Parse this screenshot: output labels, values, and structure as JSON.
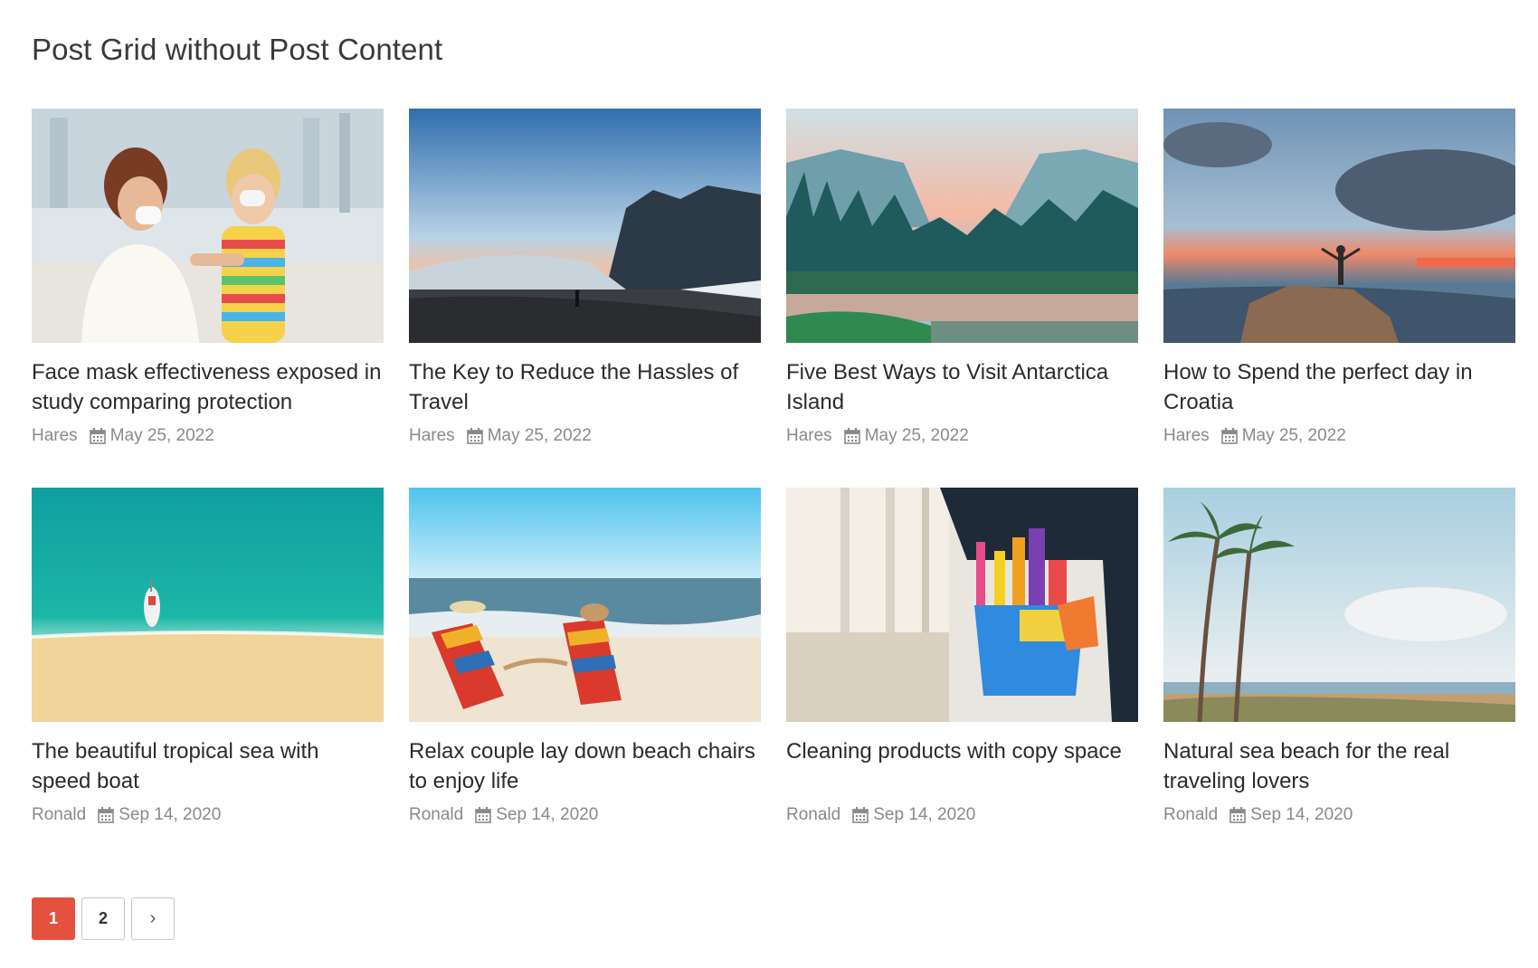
{
  "page": {
    "title": "Post Grid without Post Content"
  },
  "posts": [
    {
      "title": "Face mask effectiveness exposed in study comparing protection",
      "author": "Hares",
      "date": "May 25, 2022",
      "image": "mother-child-face-mask-photo"
    },
    {
      "title": "The Key to Reduce the Hassles of Travel",
      "author": "Hares",
      "date": "May 25, 2022",
      "image": "mountain-misty-valley-photo"
    },
    {
      "title": "Five Best Ways to Visit Antarctica Island",
      "author": "Hares",
      "date": "May 25, 2022",
      "image": "forest-river-valley-photo"
    },
    {
      "title": "How to Spend the perfect day in Croatia",
      "author": "Hares",
      "date": "May 25, 2022",
      "image": "man-on-rock-sunset-photo"
    },
    {
      "title": "The beautiful tropical sea with speed boat",
      "author": "Ronald",
      "date": "Sep 14, 2020",
      "image": "tropical-sea-boat-photo"
    },
    {
      "title": "Relax couple lay down beach chairs to enjoy life",
      "author": "Ronald",
      "date": "Sep 14, 2020",
      "image": "beach-chairs-couple-photo"
    },
    {
      "title": "Cleaning products with copy space",
      "author": "Ronald",
      "date": "Sep 14, 2020",
      "image": "cleaning-products-bucket-photo"
    },
    {
      "title": "Natural sea beach for the real traveling lovers",
      "author": "Ronald",
      "date": "Sep 14, 2020",
      "image": "palm-trees-beach-photo"
    }
  ],
  "pagination": {
    "current": "1",
    "page2": "2",
    "next": "›"
  },
  "colors": {
    "accent": "#e4513f",
    "meta_text": "#8a8a8a",
    "title_text": "#2b2b2b"
  },
  "icons": {
    "date": "calendar-icon",
    "next": "chevron-right-icon"
  }
}
